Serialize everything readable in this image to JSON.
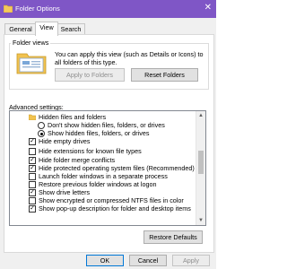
{
  "window": {
    "title": "Folder Options",
    "close_glyph": "✕"
  },
  "tabs": [
    {
      "label": "General",
      "active": false
    },
    {
      "label": "View",
      "active": true
    },
    {
      "label": "Search",
      "active": false
    }
  ],
  "folder_views": {
    "legend": "Folder views",
    "description": "You can apply this view (such as Details or Icons) to all folders of this type.",
    "apply_label": "Apply to Folders",
    "reset_label": "Reset Folders"
  },
  "advanced": {
    "label": "Advanced settings:",
    "items": [
      {
        "type": "folder",
        "label": "Hidden files and folders"
      },
      {
        "type": "radio",
        "checked": false,
        "label": "Don't show hidden files, folders, or drives"
      },
      {
        "type": "radio",
        "checked": true,
        "label": "Show hidden files, folders, or drives"
      },
      {
        "type": "checkbox",
        "checked": true,
        "label": "Hide empty drives"
      },
      {
        "type": "checkbox",
        "checked": false,
        "label": "Hide extensions for known file types",
        "highlighted": true
      },
      {
        "type": "checkbox",
        "checked": true,
        "label": "Hide folder merge conflicts"
      },
      {
        "type": "checkbox",
        "checked": true,
        "label": "Hide protected operating system files (Recommended)"
      },
      {
        "type": "checkbox",
        "checked": false,
        "label": "Launch folder windows in a separate process"
      },
      {
        "type": "checkbox",
        "checked": false,
        "label": "Restore previous folder windows at logon"
      },
      {
        "type": "checkbox",
        "checked": true,
        "label": "Show drive letters"
      },
      {
        "type": "checkbox",
        "checked": false,
        "label": "Show encrypted or compressed NTFS files in color"
      },
      {
        "type": "checkbox",
        "checked": true,
        "label": "Show pop-up description for folder and desktop items"
      }
    ],
    "restore_label": "Restore Defaults"
  },
  "footer": {
    "ok": "OK",
    "cancel": "Cancel",
    "apply": "Apply"
  },
  "colors": {
    "titlebar": "#7f56c6",
    "highlight": "#ffff3a"
  },
  "icons": {
    "check_glyph": "✓"
  }
}
